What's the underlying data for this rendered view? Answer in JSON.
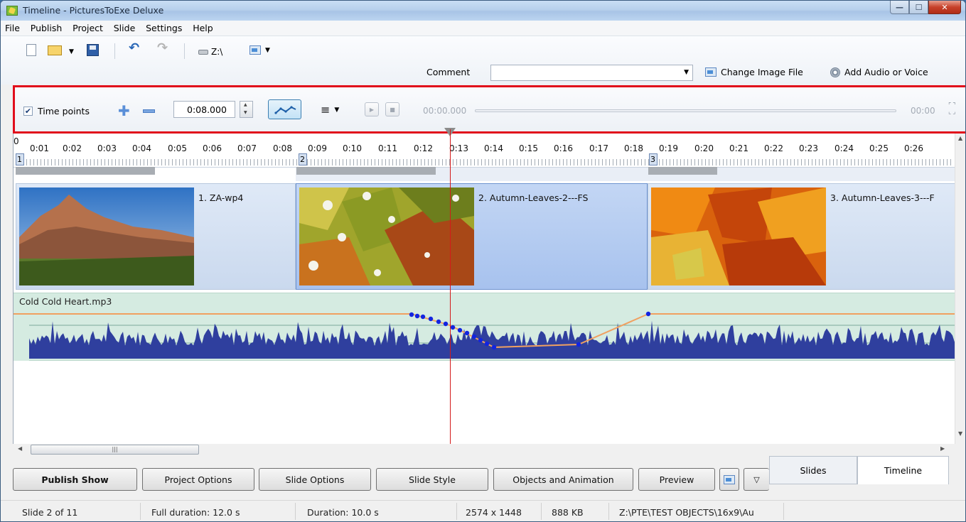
{
  "window": {
    "title": "Timeline - PicturesToExe Deluxe"
  },
  "menu": [
    "File",
    "Publish",
    "Project",
    "Slide",
    "Settings",
    "Help"
  ],
  "toolbar": {
    "drive_label": "Z:\\",
    "comment_label": "Comment",
    "comment_value": "",
    "change_image_label": "Change Image File",
    "add_audio_label": "Add Audio or Voice"
  },
  "time_points": {
    "checkbox_label": "Time points",
    "checked": true,
    "time_value": "0:08.000",
    "playback_start": "00:00.000",
    "playback_end": "00:00"
  },
  "ruler": {
    "ticks": [
      "0",
      "0:01",
      "0:02",
      "0:03",
      "0:04",
      "0:05",
      "0:06",
      "0:07",
      "0:08",
      "0:09",
      "0:10",
      "0:11",
      "0:12",
      "0:13",
      "0:14",
      "0:15",
      "0:16",
      "0:17",
      "0:18",
      "0:19",
      "0:20",
      "0:21",
      "0:22",
      "0:23",
      "0:24",
      "0:25",
      "0:26"
    ],
    "slide_markers": [
      "1",
      "2",
      "3"
    ]
  },
  "slides": [
    {
      "name": "1. ZA-wp4",
      "selected": false
    },
    {
      "name": "2. Autumn-Leaves-2---FS",
      "selected": true
    },
    {
      "name": "3. Autumn-Leaves-3---F",
      "selected": false
    }
  ],
  "audio": {
    "name": "Cold Cold Heart.mp3",
    "waveform_color": "#2f3f9e",
    "envelope_color": "#f0a060",
    "track_color": "#d5ebe1"
  },
  "buttons": {
    "publish": "Publish Show",
    "project_options": "Project Options",
    "slide_options": "Slide Options",
    "slide_style": "Slide Style",
    "objects_animation": "Objects and Animation",
    "preview": "Preview"
  },
  "tabs": {
    "slides": "Slides",
    "timeline": "Timeline",
    "active": "Timeline"
  },
  "status": {
    "slide": "Slide 2 of 11",
    "full_duration": "Full duration: 12.0 s",
    "duration": "Duration: 10.0 s",
    "resolution": "2574 x 1448",
    "size": "888 KB",
    "path": "Z:\\PTE\\TEST OBJECTS\\16x9\\Au"
  },
  "colors": {
    "highlight": "#e10d1b",
    "playhead": "#d41a1a",
    "selected_slide": "#a7c2ee"
  }
}
